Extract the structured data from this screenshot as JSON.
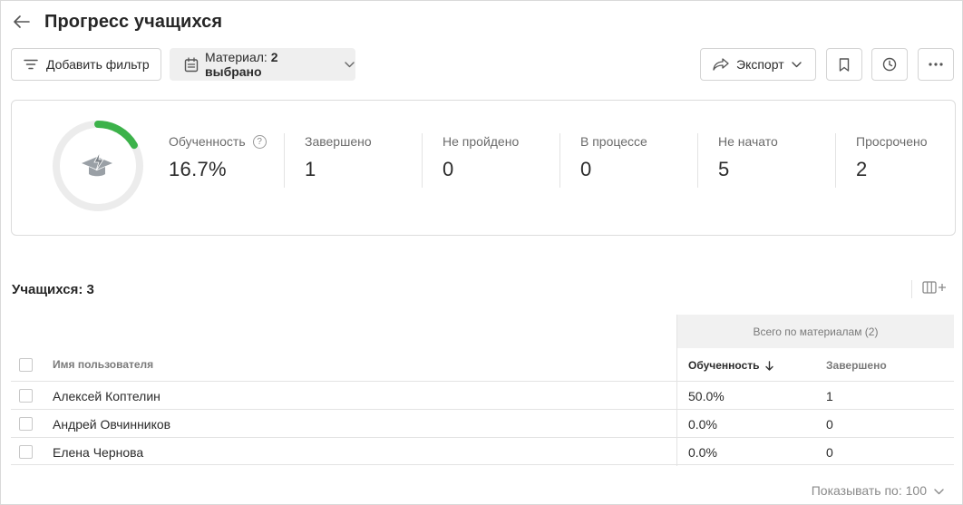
{
  "page": {
    "title": "Прогресс учащихся"
  },
  "toolbar": {
    "add_filter_label": "Добавить фильтр",
    "material_label": "Материал:",
    "material_value": "2 выбрано",
    "export_label": "Экспорт"
  },
  "stats": {
    "progress_fraction": 0.167,
    "progress_color": "#3cb24a",
    "track_color": "#ececec",
    "items": [
      {
        "label": "Обученность",
        "value": "16.7%",
        "help": "?"
      },
      {
        "label": "Завершено",
        "value": "1"
      },
      {
        "label": "Не пройдено",
        "value": "0"
      },
      {
        "label": "В процессе",
        "value": "0"
      },
      {
        "label": "Не начато",
        "value": "5"
      },
      {
        "label": "Просрочено",
        "value": "2"
      }
    ]
  },
  "learners": {
    "title": "Учащихся: 3"
  },
  "table": {
    "group_header": "Всего по материалам (2)",
    "columns": {
      "name": "Имя пользователя",
      "progress": "Обученность",
      "completed": "Завершено"
    },
    "rows": [
      {
        "name": "Алексей Коптелин",
        "progress": "50.0%",
        "completed": "1"
      },
      {
        "name": "Андрей Овчинников",
        "progress": "0.0%",
        "completed": "0"
      },
      {
        "name": "Елена Чернова",
        "progress": "0.0%",
        "completed": "0"
      }
    ]
  },
  "pager": {
    "label": "Показывать по: 100"
  },
  "icons": {
    "back": "arrow-left-icon",
    "filter": "filter-lines-icon",
    "calendar": "calendar-icon",
    "export": "share-arrow-icon",
    "bookmark": "bookmark-icon",
    "history": "clock-icon",
    "more": "more-dots-icon",
    "graduation": "graduation-cap-icon",
    "columns": "columns-add-icon",
    "sort": "arrow-down-icon"
  }
}
